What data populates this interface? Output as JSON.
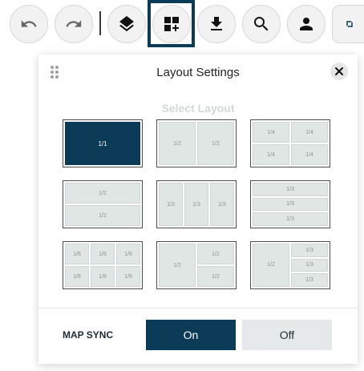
{
  "toolbar": {
    "buttons": [
      {
        "name": "undo",
        "icon": "undo-icon"
      },
      {
        "name": "redo",
        "icon": "redo-icon"
      },
      {
        "name": "layers",
        "icon": "layers-icon"
      },
      {
        "name": "layout",
        "icon": "grid-add-icon",
        "active": true
      },
      {
        "name": "download",
        "icon": "download-icon"
      },
      {
        "name": "search",
        "icon": "search-icon"
      },
      {
        "name": "account",
        "icon": "person-icon"
      },
      {
        "name": "expand",
        "icon": "expand-corner-icon"
      }
    ]
  },
  "panel": {
    "title": "Layout Settings",
    "close_icon": "close-icon",
    "select_layout_label": "Select Layout",
    "layouts": [
      {
        "id": "single",
        "cells": [
          "1/1"
        ],
        "selected": true
      },
      {
        "id": "halves-vertical",
        "cells": [
          "1/2",
          "1/2"
        ]
      },
      {
        "id": "quarters",
        "cells": [
          "1/4",
          "1/4",
          "1/4",
          "1/4"
        ]
      },
      {
        "id": "halves-horizontal",
        "cells": [
          "1/2",
          "1/2"
        ]
      },
      {
        "id": "thirds-vertical",
        "cells": [
          "1/3",
          "1/3",
          "1/3"
        ]
      },
      {
        "id": "thirds-horizontal",
        "cells": [
          "1/3",
          "1/3",
          "1/3"
        ]
      },
      {
        "id": "sixths",
        "cells": [
          "1/6",
          "1/6",
          "1/6",
          "1/6",
          "1/6",
          "1/6"
        ]
      },
      {
        "id": "half-left-two-right",
        "cells": [
          "1/2",
          "1/2",
          "1/2"
        ]
      },
      {
        "id": "half-left-three-right",
        "cells": [
          "1/2",
          "1/3",
          "1/3",
          "1/3"
        ]
      }
    ],
    "map_sync": {
      "label": "MAP SYNC",
      "on_label": "On",
      "off_label": "Off",
      "value": "On"
    }
  },
  "colors": {
    "accent": "#0c3b57",
    "cell_fill": "#e0e6e4",
    "off_button": "#e6e9e9"
  }
}
